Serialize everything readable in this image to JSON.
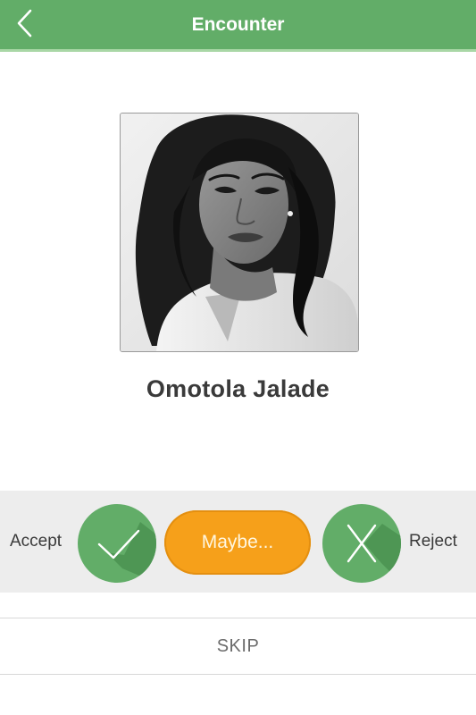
{
  "header": {
    "title": "Encounter",
    "back_icon": "chevron-left-icon"
  },
  "profile": {
    "name": "Omotola Jalade",
    "photo": "portrait-photo"
  },
  "actions": {
    "accept_label": "Accept",
    "accept_icon": "checkmark-icon",
    "maybe_label": "Maybe...",
    "reject_label": "Reject",
    "reject_icon": "x-icon"
  },
  "skip": {
    "label": "SKIP"
  },
  "colors": {
    "primary_green": "#62ad68",
    "maybe_orange": "#f6a01a",
    "band_gray": "#ededed"
  }
}
